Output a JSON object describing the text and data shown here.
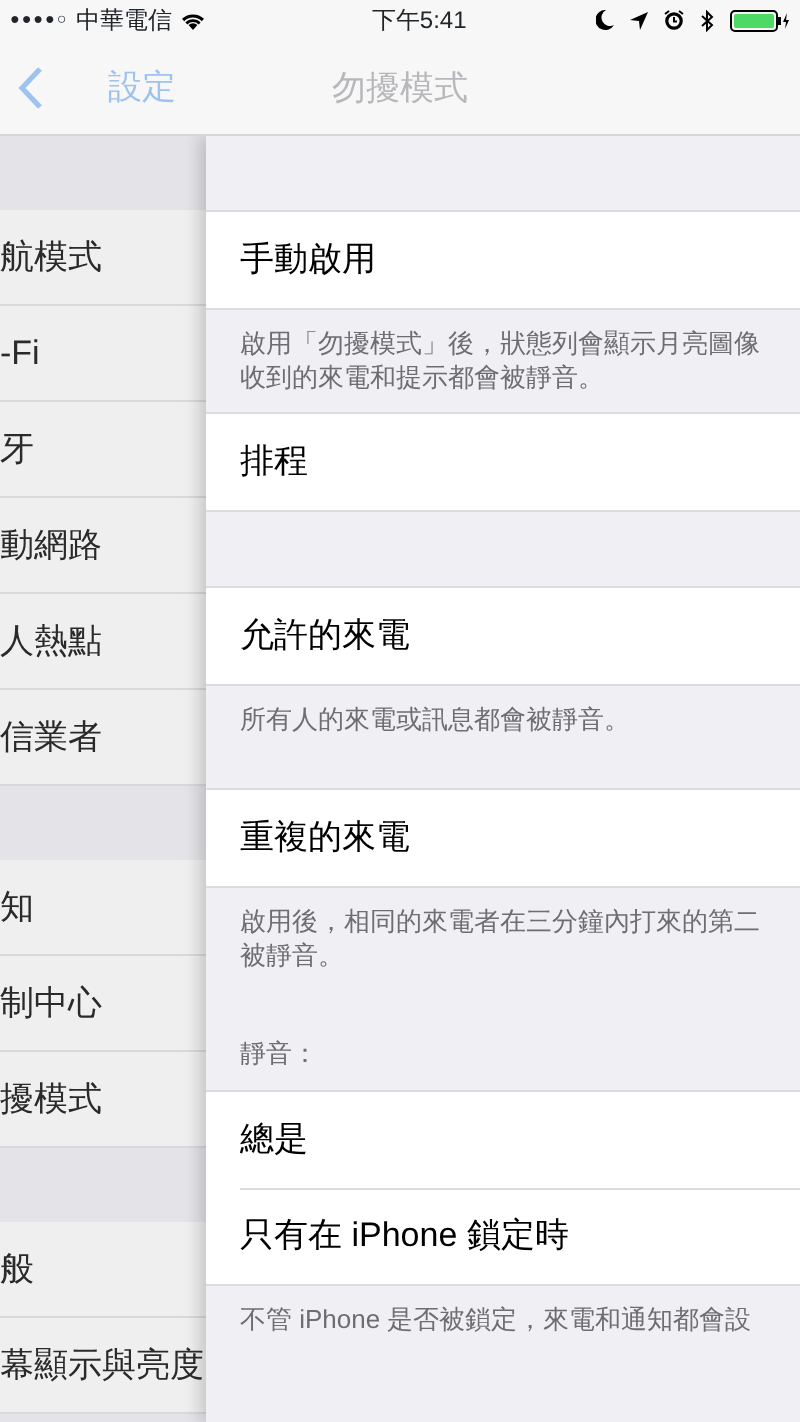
{
  "status_bar": {
    "signal": "●●●●○",
    "carrier": "中華電信",
    "time": "下午5:41"
  },
  "nav_bar": {
    "back_label": "設定",
    "title": "勿擾模式"
  },
  "sidebar": {
    "groups": [
      {
        "items": [
          {
            "label": "航模式"
          },
          {
            "label": "-Fi"
          },
          {
            "label": "牙"
          },
          {
            "label": "動網路"
          },
          {
            "label": "人熱點"
          },
          {
            "label": "信業者"
          }
        ]
      },
      {
        "items": [
          {
            "label": "知"
          },
          {
            "label": "制中心"
          },
          {
            "label": "擾模式"
          }
        ]
      },
      {
        "items": [
          {
            "label": "般"
          },
          {
            "label": "幕顯示與亮度"
          }
        ]
      }
    ]
  },
  "detail": {
    "sections": [
      {
        "rows": [
          {
            "label": "手動啟用"
          }
        ],
        "footer": "啟用「勿擾模式」後，狀態列會顯示月亮圖像收到的來電和提示都會被靜音。"
      },
      {
        "rows": [
          {
            "label": "排程"
          }
        ]
      },
      {
        "rows": [
          {
            "label": "允許的來電"
          }
        ],
        "footer": "所有人的來電或訊息都會被靜音。"
      },
      {
        "rows": [
          {
            "label": "重複的來電"
          }
        ],
        "footer": "啟用後，相同的來電者在三分鐘內打來的第二被靜音。"
      },
      {
        "header": "靜音：",
        "rows": [
          {
            "label": "總是"
          },
          {
            "label": "只有在 iPhone 鎖定時"
          }
        ],
        "footer": "不管 iPhone 是否被鎖定，來電和通知都會設"
      }
    ]
  }
}
